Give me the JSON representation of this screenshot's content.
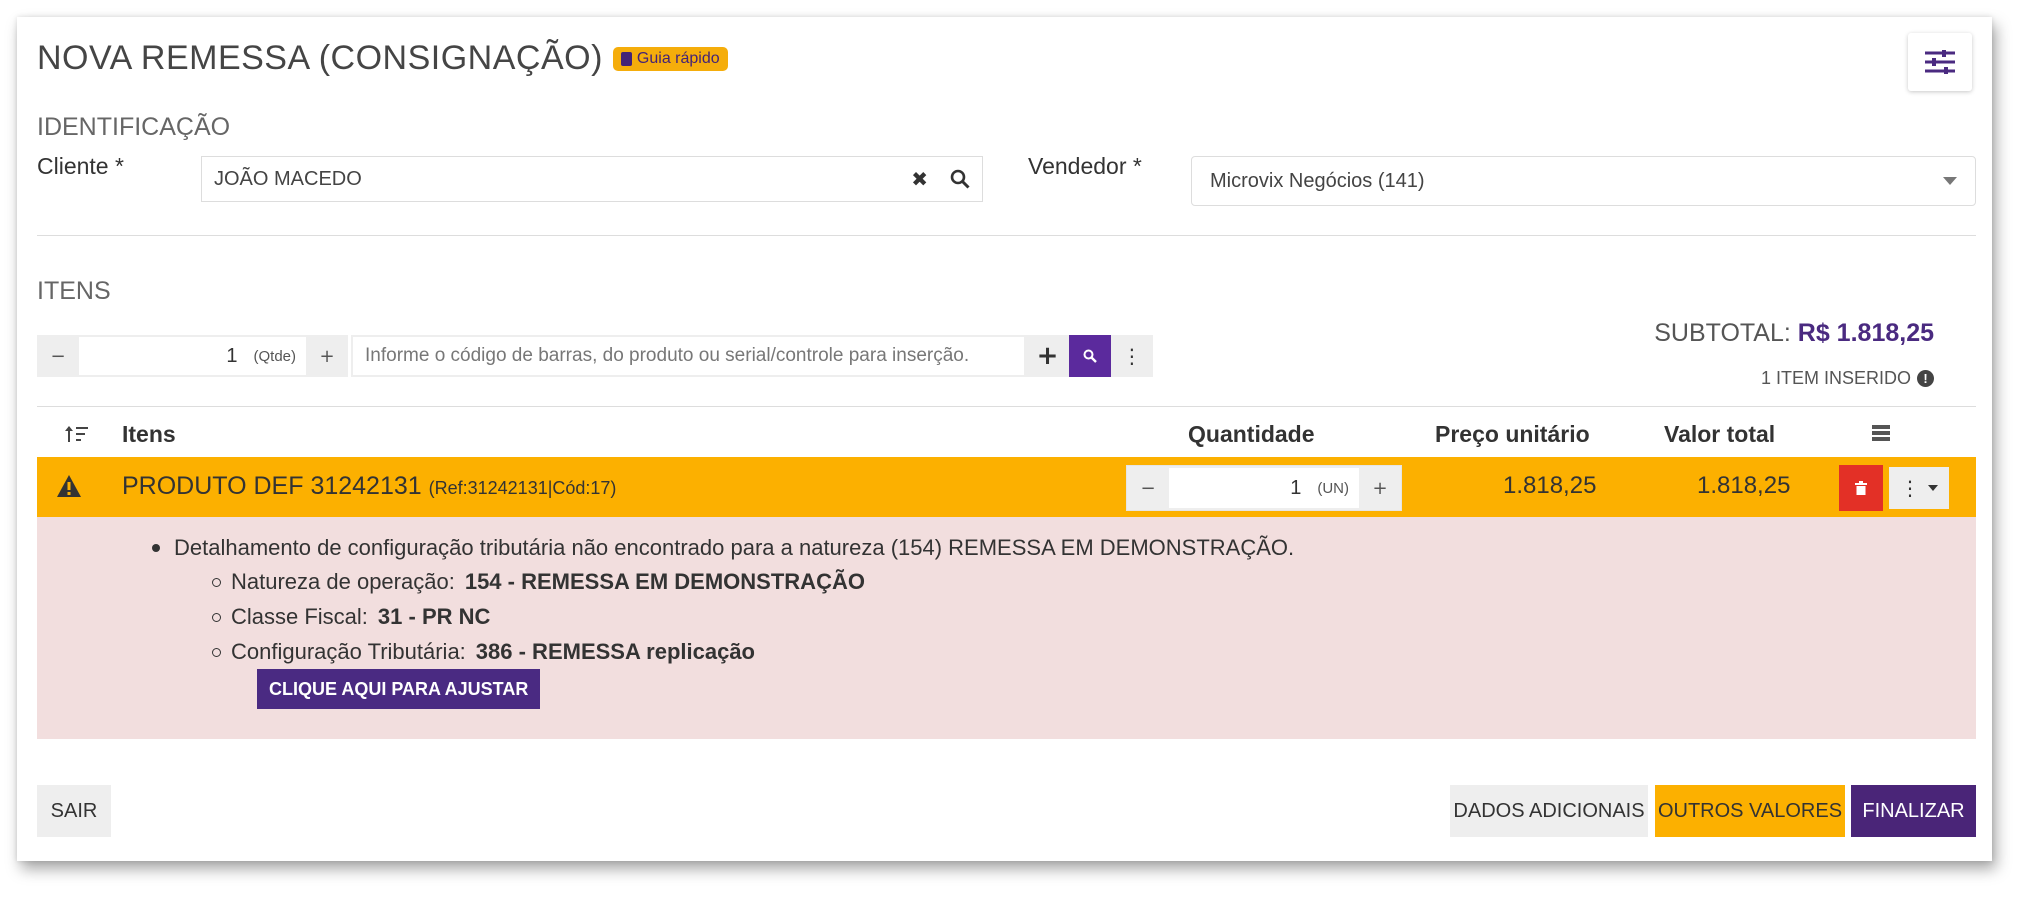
{
  "header": {
    "title": "NOVA REMESSA (CONSIGNAÇÃO)",
    "guide_badge": "Guia rápido"
  },
  "identification": {
    "section_title": "IDENTIFICAÇÃO",
    "client_label": "Cliente *",
    "client_value": "JOÃO MACEDO",
    "seller_label": "Vendedor *",
    "seller_value": "Microvix Negócios (141)"
  },
  "items_section": {
    "section_title": "ITENS",
    "qty_minus": "−",
    "qty_value": "1",
    "qty_unit": "(Qtde)",
    "qty_plus": "+",
    "barcode_placeholder": "Informe o código de barras, do produto ou serial/controle para inserção.",
    "subtotal_label": "SUBTOTAL:",
    "subtotal_value": "R$ 1.818,25",
    "items_count": "1 ITEM INSERIDO"
  },
  "table": {
    "columns": [
      "Itens",
      "Quantidade",
      "Preço unitário",
      "Valor total"
    ],
    "row": {
      "name": "PRODUTO DEF 31242131",
      "ref": "(Ref:31242131|Cód:17)",
      "qty": "1",
      "unit": "(UN)",
      "unit_price": "1.818,25",
      "total": "1.818,25"
    }
  },
  "error": {
    "message": "Detalhamento de configuração tributária não encontrado para a natureza (154) REMESSA EM DEMONSTRAÇÃO.",
    "details": [
      {
        "label": "Natureza de operação:",
        "value": "154 - REMESSA EM DEMONSTRAÇÃO"
      },
      {
        "label": "Classe Fiscal:",
        "value": "31 - PR NC"
      },
      {
        "label": "Configuração Tributária:",
        "value": "386 - REMESSA replicação"
      }
    ],
    "adjust_button": "CLIQUE AQUI PARA AJUSTAR"
  },
  "footer": {
    "exit": "SAIR",
    "additional_data": "DADOS ADICIONAIS",
    "other_values": "OUTROS VALORES",
    "finish": "FINALIZAR"
  },
  "colors": {
    "accent_orange": "#fcb000",
    "purple_dark": "#432377",
    "purple": "#5b2a9d",
    "delete_red": "#e33026",
    "error_bg": "#f2dede"
  }
}
